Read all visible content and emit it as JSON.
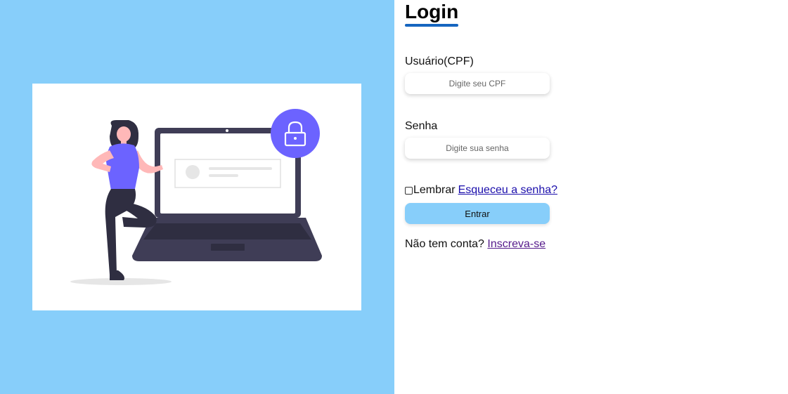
{
  "colors": {
    "left_panel_bg": "#87cefa",
    "button_bg": "#87cefa",
    "title_underline": "#1565c0",
    "illustration_accent": "#6c63ff",
    "illustration_dark": "#3f3d56"
  },
  "illustration": {
    "description_icon": "person-with-laptop-lock-illustration",
    "lock_icon": "lock-icon"
  },
  "login": {
    "title": "Login",
    "username": {
      "label": "Usuário(CPF)",
      "placeholder": "Digite seu CPF",
      "value": ""
    },
    "password": {
      "label": "Senha",
      "placeholder": "Digite sua senha",
      "value": ""
    },
    "remember": {
      "label": "Lembrar",
      "checked": false
    },
    "forgot_link": "Esqueceu a senha?",
    "submit_label": "Entrar",
    "signup_prompt": "Não tem conta?",
    "signup_link": "Inscreva-se"
  }
}
